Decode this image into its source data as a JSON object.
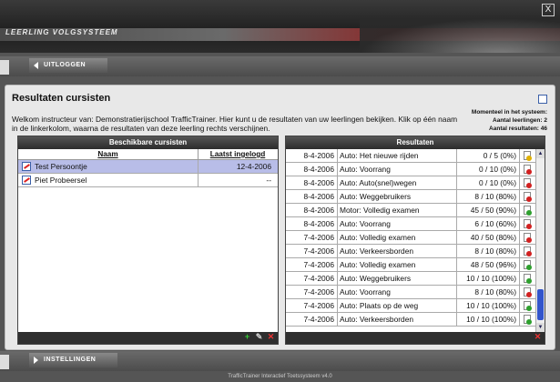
{
  "app": {
    "banner_title": "LEERLING VOLGSYSTEEM",
    "close_label": "X",
    "footer": "TrafficTrainer Interactief Toetssysteem v4.0"
  },
  "nav": {
    "logout_label": "UITLOGGEN",
    "settings_label": "INSTELLINGEN"
  },
  "page": {
    "title": "Resultaten cursisten",
    "intro": "Welkom instructeur van: Demonstratierijschool TrafficTrainer. Hier kunt u de resultaten van uw leerlingen bekijken. Klik op één naam in de linkerkolom, waarna de resultaten van deze leerling rechts verschijnen."
  },
  "stats": {
    "line1": "Momenteel in het systeem:",
    "students_label": "Aantal leerlingen:",
    "students_value": "2",
    "results_label": "Aantal resultaten:",
    "results_value": "46"
  },
  "left": {
    "header": "Beschikbare cursisten",
    "col_name": "Naam",
    "col_login": "Laatst ingelogd",
    "rows": [
      {
        "name": "Test Persoontje",
        "login": "12-4-2006",
        "selected": true
      },
      {
        "name": "Piet Probeersel",
        "login": "--",
        "selected": false
      }
    ],
    "footer_icons": [
      "add-icon",
      "edit-icon",
      "delete-icon"
    ]
  },
  "right": {
    "header": "Resultaten",
    "rows": [
      {
        "date": "8-4-2006",
        "title": "Auto: Het nieuwe rijden",
        "score": "0 / 5 (0%)",
        "status": "warn"
      },
      {
        "date": "8-4-2006",
        "title": "Auto: Voorrang",
        "score": "0 / 10 (0%)",
        "status": "fail"
      },
      {
        "date": "8-4-2006",
        "title": "Auto: Auto(snel)wegen",
        "score": "0 / 10 (0%)",
        "status": "fail"
      },
      {
        "date": "8-4-2006",
        "title": "Auto: Weggebruikers",
        "score": "8 / 10 (80%)",
        "status": "fail"
      },
      {
        "date": "8-4-2006",
        "title": "Motor: Volledig examen",
        "score": "45 / 50 (90%)",
        "status": "pass"
      },
      {
        "date": "8-4-2006",
        "title": "Auto: Voorrang",
        "score": "6 / 10 (60%)",
        "status": "fail"
      },
      {
        "date": "7-4-2006",
        "title": "Auto: Volledig examen",
        "score": "40 / 50 (80%)",
        "status": "fail"
      },
      {
        "date": "7-4-2006",
        "title": "Auto: Verkeersborden",
        "score": "8 / 10 (80%)",
        "status": "fail"
      },
      {
        "date": "7-4-2006",
        "title": "Auto: Volledig examen",
        "score": "48 / 50 (96%)",
        "status": "pass"
      },
      {
        "date": "7-4-2006",
        "title": "Auto: Weggebruikers",
        "score": "10 / 10 (100%)",
        "status": "pass"
      },
      {
        "date": "7-4-2006",
        "title": "Auto: Voorrang",
        "score": "8 / 10 (80%)",
        "status": "fail"
      },
      {
        "date": "7-4-2006",
        "title": "Auto: Plaats op de weg",
        "score": "10 / 10 (100%)",
        "status": "pass"
      },
      {
        "date": "7-4-2006",
        "title": "Auto: Verkeersborden",
        "score": "10 / 10 (100%)",
        "status": "pass"
      }
    ],
    "footer_icons": [
      "delete-icon"
    ]
  },
  "colors": {
    "pass": "#2ea02e",
    "fail": "#d22020",
    "warn": "#e0b000",
    "selected_row": "#b8bde8"
  }
}
